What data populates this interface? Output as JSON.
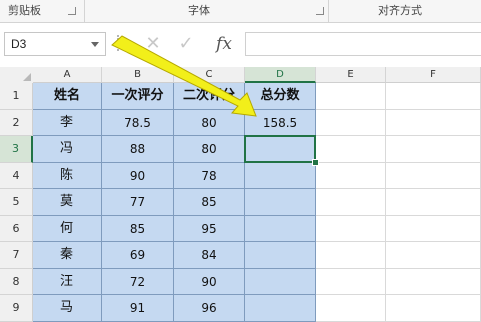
{
  "ribbon": {
    "groups": [
      {
        "label": "剪贴板"
      },
      {
        "label": "字体"
      },
      {
        "label": "对齐方式"
      }
    ]
  },
  "formula_bar": {
    "name_box": "D3",
    "cancel_icon": "✕",
    "enter_icon": "✓",
    "fx_label": "fx",
    "formula_value": ""
  },
  "sheet": {
    "columns": [
      "A",
      "B",
      "C",
      "D",
      "E",
      "F"
    ],
    "rows": [
      "1",
      "2",
      "3",
      "4",
      "5",
      "6",
      "7",
      "8",
      "9"
    ],
    "header_row": [
      "姓名",
      "一次评分",
      "二次评分",
      "总分数"
    ],
    "records": [
      {
        "name": "李",
        "s1": "78.5",
        "s2": "80",
        "total": "158.5"
      },
      {
        "name": "冯",
        "s1": "88",
        "s2": "80",
        "total": ""
      },
      {
        "name": "陈",
        "s1": "90",
        "s2": "78",
        "total": ""
      },
      {
        "name": "莫",
        "s1": "77",
        "s2": "85",
        "total": ""
      },
      {
        "name": "何",
        "s1": "85",
        "s2": "95",
        "total": ""
      },
      {
        "name": "秦",
        "s1": "69",
        "s2": "84",
        "total": ""
      },
      {
        "name": "汪",
        "s1": "72",
        "s2": "90",
        "total": ""
      },
      {
        "name": "马",
        "s1": "91",
        "s2": "96",
        "total": ""
      }
    ],
    "active_cell": "D3"
  },
  "colors": {
    "table_fill": "#c5d9f1",
    "selection": "#217346",
    "arrow": "#f2ef1a"
  }
}
